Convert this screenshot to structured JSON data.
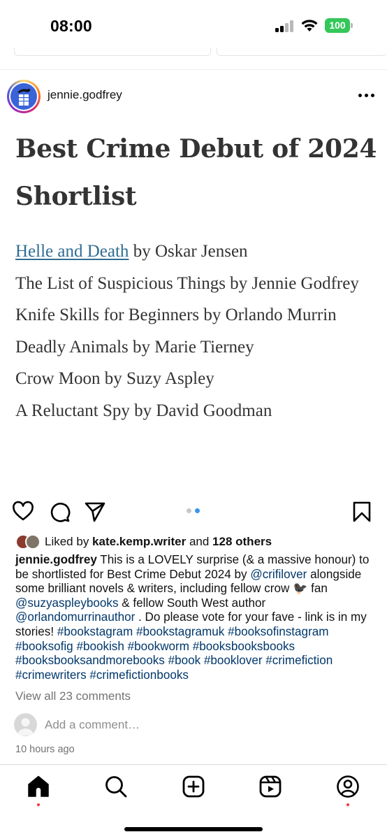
{
  "status_bar": {
    "time": "08:00",
    "battery": "100",
    "icons": [
      "signal-icon",
      "wifi-icon",
      "battery-icon"
    ]
  },
  "post": {
    "username": "jennie.godfrey",
    "image": {
      "title": "Best Crime Debut of 2024 Shortlist",
      "books": [
        {
          "link_title": "Helle and Death",
          "rest": " by Oskar Jensen"
        },
        {
          "text": "The List of Suspicious Things by Jennie Godfrey"
        },
        {
          "text": "Knife Skills for Beginners by Orlando Murrin"
        },
        {
          "text": "Deadly Animals by Marie Tierney"
        },
        {
          "text": "Crow Moon by Suzy Aspley"
        },
        {
          "text": "A Reluctant Spy by David Goodman"
        }
      ]
    },
    "carousel": {
      "count": 2,
      "active": 2
    },
    "likes": {
      "prefix": "Liked by ",
      "user": "kate.kemp.writer",
      "middle": " and ",
      "others": "128 others"
    },
    "caption": {
      "username": "jennie.godfrey",
      "text1": " This is a LOVELY surprise (& a massive honour) to be shortlisted for Best Crime Debut 2024 by ",
      "mention1": "@crifilover",
      "text2": " alongside some brilliant novels & writers, including fellow crow ",
      "emoji": "🐦‍⬛",
      "text3": " fan ",
      "mention2": "@suzyaspleybooks",
      "text4": " & fellow South West author ",
      "mention3": "@orlandomurrinauthor",
      "text5": " . Do please vote for your fave - link is in my stories! ",
      "hashtags": [
        "#bookstagram",
        "#bookstagramuk",
        "#booksofinstagram",
        "#booksofig",
        "#bookish",
        "#bookworm",
        "#booksbooksbooks",
        "#booksbooksandmorebooks",
        "#book",
        "#booklover",
        "#crimefiction",
        "#crimewriters",
        "#crimefictionbooks"
      ]
    },
    "view_comments": "View all 23 comments",
    "comment_placeholder": "Add a comment…",
    "time_ago": "10 hours ago"
  },
  "nav": {
    "items": [
      "home-icon",
      "search-icon",
      "create-icon",
      "reels-icon",
      "profile-icon"
    ],
    "active": "home-icon"
  },
  "colors": {
    "link": "#2f6d92",
    "hashtag": "#00376b",
    "notification_dot": "#ff3040",
    "battery": "#34c759",
    "carousel_active": "#3897f0"
  }
}
